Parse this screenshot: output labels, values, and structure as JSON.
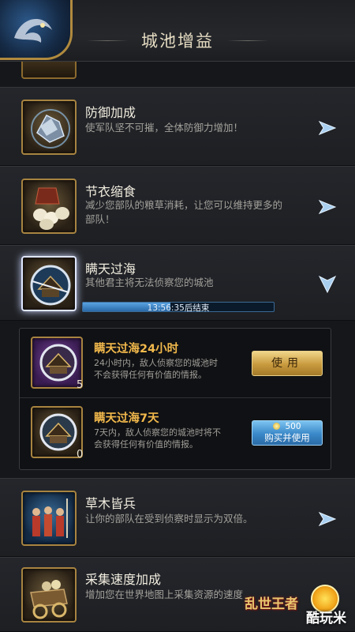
{
  "header": {
    "title": "城池增益"
  },
  "rows": [
    {
      "title": "防御加成",
      "desc": "使军队坚不可摧，全体防御力增加！",
      "icon": "shield-icon"
    },
    {
      "title": "节衣缩食",
      "desc_line1": "减少您部队的粮草消耗，让您可以维持更多的",
      "desc_line2": "部队！",
      "icon": "food-icon"
    },
    {
      "title": "瞒天过海",
      "desc": "其他君主将无法侦察您的城池",
      "icon": "hidden-city-icon",
      "timer": "13:56:35后结束",
      "timer_progress": 0.46
    },
    {
      "title": "草木皆兵",
      "desc": "让你的部队在受到侦察时显示为双倍。",
      "icon": "soldiers-icon"
    },
    {
      "title": "采集速度加成",
      "desc": "增加您在世界地图上采集资源的速度",
      "icon": "cart-icon"
    }
  ],
  "items": [
    {
      "title": "瞒天过海24小时",
      "desc_line1": "24小时内，敌人侦察您的城池时",
      "desc_line2": "不会获得任何有价值的情报。",
      "count": "5",
      "button": "使用"
    },
    {
      "title": "瞒天过海7天",
      "desc_line1": "7天内，敌人侦察您的城池时将不",
      "desc_line2": "会获得任何有价值的情报。",
      "count": "0",
      "price": "500",
      "button": "购买并使用"
    }
  ],
  "watermark": {
    "game": "乱世王者",
    "site": "酷玩米"
  },
  "colors": {
    "gold": "#a88440",
    "title_orange": "#f2b94c",
    "timer_blue": "#3b6a94"
  }
}
